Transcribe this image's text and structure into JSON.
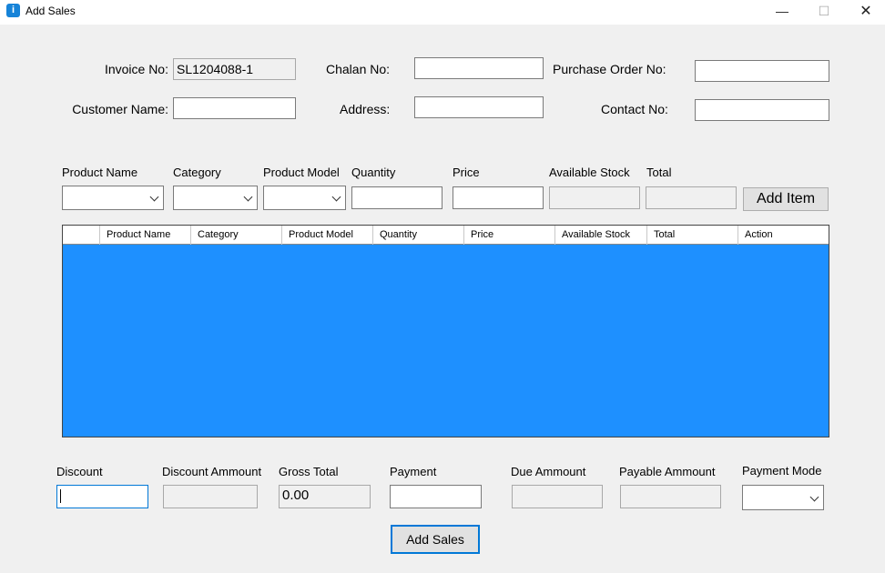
{
  "window": {
    "title": "Add Sales",
    "icon": "info-app-icon"
  },
  "header": {
    "invoice_no": {
      "label": "Invoice No:",
      "value": "SL1204088-1"
    },
    "chalan_no": {
      "label": "Chalan No:",
      "value": ""
    },
    "purchase_order_no": {
      "label": "Purchase Order No:",
      "value": ""
    },
    "customer_name": {
      "label": "Customer Name:",
      "value": ""
    },
    "address": {
      "label": "Address:",
      "value": ""
    },
    "contact_no": {
      "label": "Contact No:",
      "value": ""
    }
  },
  "item_entry": {
    "product_name_label": "Product Name",
    "category_label": "Category",
    "product_model_label": "Product Model",
    "quantity_label": "Quantity",
    "price_label": "Price",
    "available_stock_label": "Available Stock",
    "total_label": "Total",
    "add_item_label": "Add Item"
  },
  "grid": {
    "columns": [
      "Product Name",
      "Category",
      "Product Model",
      "Quantity",
      "Price",
      "Available Stock",
      "Total",
      "Action"
    ],
    "rows": [],
    "background": "#1e90ff"
  },
  "summary": {
    "discount_label": "Discount",
    "discount_amount_label": "Discount Ammount",
    "gross_total_label": "Gross Total",
    "gross_total_value": "0.00",
    "payment_label": "Payment",
    "due_amount_label": "Due Ammount",
    "payable_amount_label": "Payable Ammount",
    "payment_mode_label": "Payment Mode",
    "add_sales_label": "Add Sales"
  },
  "colors": {
    "accent": "#0078d7",
    "grid_background": "#1e90ff",
    "window_background": "#f0f0f0"
  }
}
